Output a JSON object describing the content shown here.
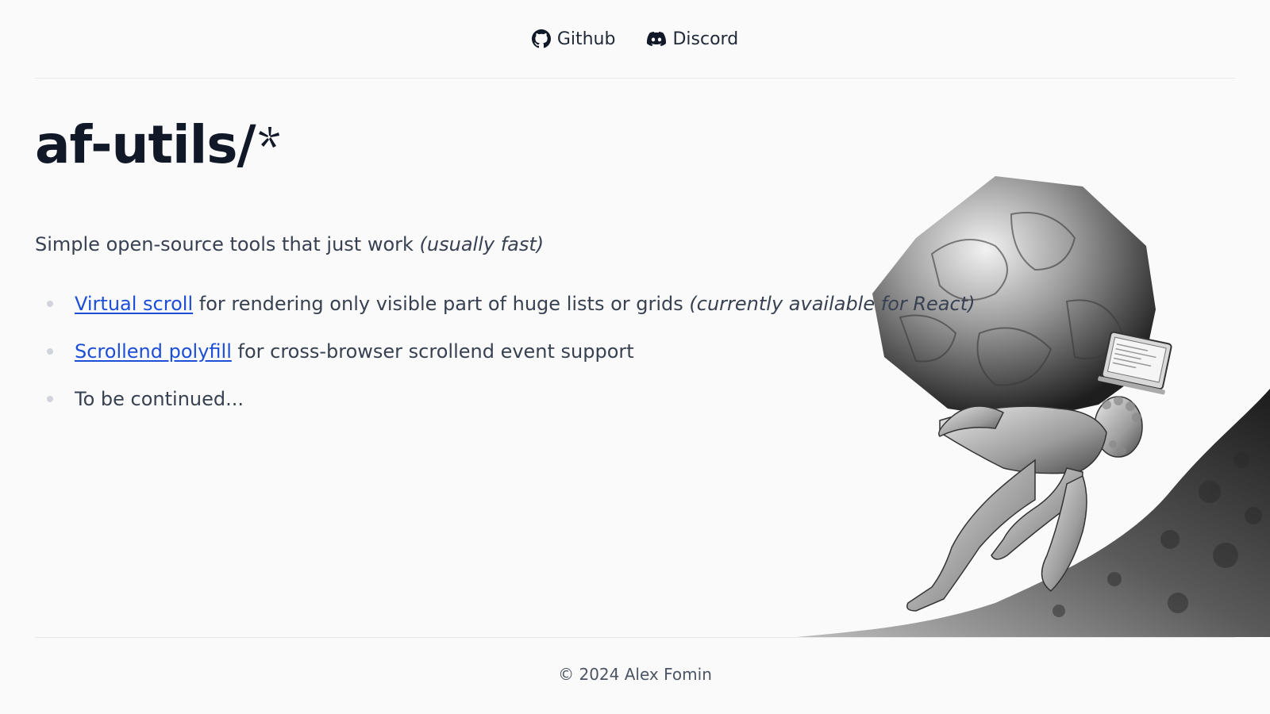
{
  "nav": {
    "github_label": "Github",
    "discord_label": "Discord"
  },
  "main": {
    "title": "af-utils/",
    "tagline": "Simple open-source tools that just work",
    "tagline_note": "(usually fast)",
    "tools": [
      {
        "link": "Virtual scroll",
        "text": " for rendering only visible part of huge lists or grids ",
        "note": "(currently available for React)"
      },
      {
        "link": "Scrollend polyfill",
        "text": " for cross-browser scrollend event support",
        "note": ""
      },
      {
        "link": "",
        "text": "To be continued...",
        "note": ""
      }
    ]
  },
  "footer": {
    "copyright": "© 2024 Alex Fomin"
  },
  "colors": {
    "background": "#fafafa",
    "link": "#1d4ed8",
    "title": "#111827"
  },
  "icons": {
    "github": "github-icon",
    "discord": "discord-icon",
    "title_mark": "asterisk-star-icon"
  }
}
